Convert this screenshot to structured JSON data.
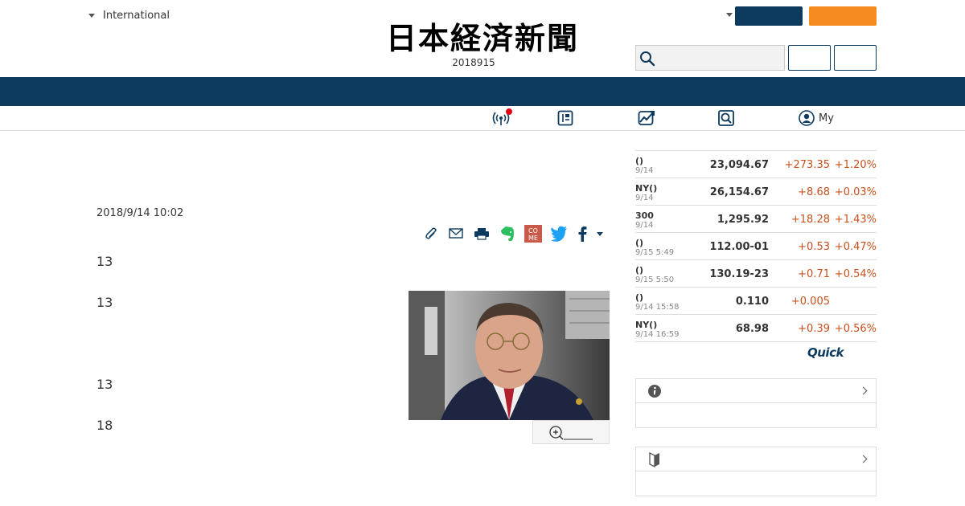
{
  "header": {
    "edition_label": "International",
    "logo_text": "日本経済新聞",
    "date_line": "2018915",
    "my_label": "My"
  },
  "article": {
    "date": "2018/9/14 10:02",
    "paragraphs": [
      "13",
      "13",
      "13",
      "18"
    ]
  },
  "market": {
    "rows": [
      {
        "name": "()",
        "date": "9/14",
        "value": "23,094.67",
        "change": "+273.35",
        "pct": "+1.20%"
      },
      {
        "name": "NY()",
        "date": "9/14",
        "value": "26,154.67",
        "change": "+8.68",
        "pct": "+0.03%"
      },
      {
        "name": "300",
        "date": "9/14",
        "value": "1,295.92",
        "change": "+18.28",
        "pct": "+1.43%"
      },
      {
        "name": "()",
        "date": "9/15 5:49",
        "value": "112.00-01",
        "change": "+0.53",
        "pct": "+0.47%"
      },
      {
        "name": "()",
        "date": "9/15 5:50",
        "value": "130.19-23",
        "change": "+0.71",
        "pct": "+0.54%"
      },
      {
        "name": "()",
        "date": "9/14 15:58",
        "value": "0.110",
        "change": "+0.005",
        "pct": ""
      },
      {
        "name": "NY()",
        "date": "9/14 16:59",
        "value": "68.98",
        "change": "+0.39",
        "pct": "+0.56%"
      }
    ],
    "provider": "Quick"
  },
  "colors": {
    "brand_navy": "#0d3a5f",
    "accent_orange": "#f68b1f",
    "positive_change": "#c8501d",
    "live_dot": "#e60012"
  },
  "icons": [
    "caret-down-icon",
    "search-icon",
    "live-broadcast-icon",
    "paper-edition-icon",
    "market-chart-icon",
    "search-news-icon",
    "user-icon",
    "clip-icon",
    "mail-icon",
    "print-icon",
    "evernote-icon",
    "come-icon",
    "twitter-icon",
    "facebook-icon",
    "zoom-in-icon",
    "info-icon",
    "beginner-mark-icon",
    "chevron-right-icon"
  ]
}
